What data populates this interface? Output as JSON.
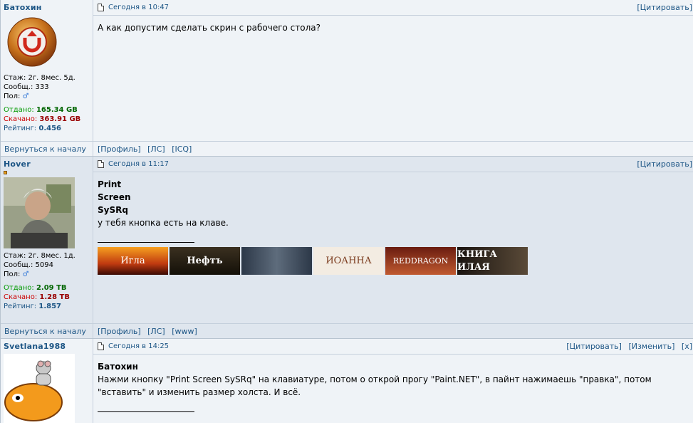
{
  "posts": [
    {
      "nick": "Батохин",
      "stazh": "Стаж: 2г. 8мес. 5д.",
      "soobsh": "Сообщ.: 333",
      "pol": "Пол:",
      "otdano_label": "Отдано:",
      "otdano": "165.34 GB",
      "skachano_label": "Скачано:",
      "skachano": "363.91 GB",
      "reiting_label": "Рейтинг:",
      "reiting": "0.456",
      "date": "Сегодня в 10:47",
      "quote": "[Цитировать]",
      "text": "А как допустим сделать скрин с рабочего стола?",
      "back": "Вернуться к началу",
      "links": [
        "[Профиль]",
        "[ЛС]",
        "[ICQ]"
      ]
    },
    {
      "nick": "Hover",
      "stazh": "Стаж: 2г. 8мес. 1д.",
      "soobsh": "Сообщ.: 5094",
      "pol": "Пол:",
      "otdano_label": "Отдано:",
      "otdano": "2.09 TB",
      "skachano_label": "Скачано:",
      "skachano": "1.28 TB",
      "reiting_label": "Рейтинг:",
      "reiting": "1.857",
      "date": "Сегодня в 11:17",
      "quote": "[Цитировать]",
      "lines": [
        "Print",
        "Screen",
        "SySRq"
      ],
      "text": "у тебя кнопка есть на клаве.",
      "banners": [
        "Игла",
        "Нефтъ",
        "",
        "ИОАННА",
        "REDDRAGON",
        "КНИГА ИЛАЯ"
      ],
      "back": "Вернуться к началу",
      "links": [
        "[Профиль]",
        "[ЛС]",
        "[www]"
      ]
    },
    {
      "nick": "Svetlana1988",
      "date": "Сегодня в 14:25",
      "actions": [
        "[Цитировать]",
        "[Изменить]",
        "[x]"
      ],
      "addressee": "Батохин",
      "text": "Нажми кнопку \"Print Screen SySRq\" на клавиатуре, потом о открой прогу \"Paint.NET\", в пайнт нажимаешь \"правка\", потом \"вставить\" и изменить размер холста. И всё."
    }
  ]
}
